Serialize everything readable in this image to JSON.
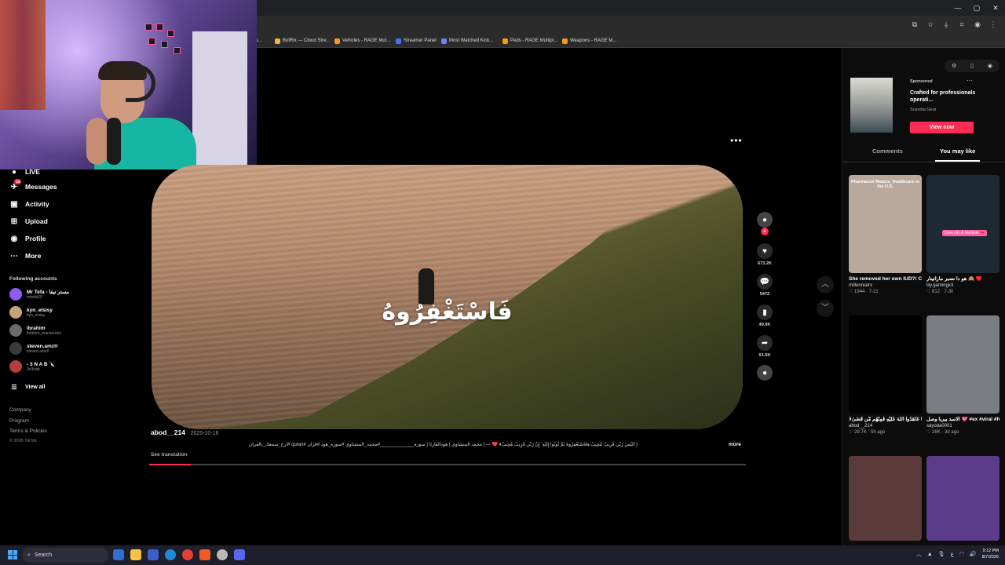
{
  "bookmarks": [
    {
      "label": "rge...",
      "color": "#888888"
    },
    {
      "label": "BotRix — Cloud Stre...",
      "color": "#e9b949"
    },
    {
      "label": "Vehicles - RAGE Mul...",
      "color": "#f39c12"
    },
    {
      "label": "Streamer Panel",
      "color": "#4a6cf7"
    },
    {
      "label": "Most Watched Kick...",
      "color": "#7c7cff"
    },
    {
      "label": "Peds - RAGE Multipl...",
      "color": "#f39c12"
    },
    {
      "label": "Weapons - RAGE M...",
      "color": "#f39c12"
    }
  ],
  "sidebar": {
    "partial_item": "LIVE",
    "messages": {
      "label": "Messages",
      "badge": "14"
    },
    "activity": "Activity",
    "upload": "Upload",
    "profile": "Profile",
    "more": "More",
    "following_title": "Following accounts",
    "accounts": [
      {
        "name": "Mr Tefa - مستر تيفا",
        "handle": "mrtefa20",
        "color": "#8b5cf6"
      },
      {
        "name": "kyn_elsisy",
        "handle": "kyn_elsisy",
        "color": "#c7a27a"
      },
      {
        "name": "ibrahim",
        "handle": "ibrahim_mansourko",
        "color": "#6b6b6b"
      },
      {
        "name": "steven.amz®",
        "handle": "steven.amz0",
        "color": "#3a3a3a"
      },
      {
        "name": "- 3 N A B 🔪",
        "handle": "3n3nab",
        "color": "#b43d3d"
      }
    ],
    "view_all": "View all",
    "footer": [
      "Company",
      "Program",
      "Terms & Policies"
    ],
    "copyright": "© 2026 TikTok"
  },
  "video": {
    "caption": "فَاسْتَغْفِرُوهُ",
    "author": "abod__214",
    "date": "· 2025-10-16",
    "description": "( أَلَيْسَ رَبِّي قَرِيبٌ مُّجِيبٌ ﴿فَاسْتَغْفِرُوهُ ثُمَّ تُوبُوا إِلَيْهِ ۚ إِنَّ رَبِّي قَرِيبٌ مُّجِيبٌ﴾ ❤️ --- | محمد المنشاوي | هودالقارئا | سورة_____________#محمد_المنشاوي #سورة_هود #قرآن #quran #ارح_سمعك_بالقران",
    "more": "more",
    "see_translation": "See translation",
    "progress": 0.07
  },
  "actions": [
    {
      "name": "avatar",
      "icon": "●",
      "count": ""
    },
    {
      "name": "like",
      "icon": "♥",
      "count": "673.2K"
    },
    {
      "name": "comment",
      "icon": "●",
      "count": "5472"
    },
    {
      "name": "save",
      "icon": "▮",
      "count": "49.9K"
    },
    {
      "name": "share",
      "icon": "➦",
      "count": "61.5K"
    },
    {
      "name": "sound",
      "icon": "●",
      "count": ""
    }
  ],
  "ad": {
    "sponsored": "Sponsored",
    "title": "Crafted for professionals operati...",
    "brand": "Scandia Gear",
    "cta": "View now"
  },
  "tabs": [
    "Comments",
    "You may like"
  ],
  "cards": [
    {
      "title": "She removed her own IUD?! Can you remove...",
      "user": "millennialrx",
      "stats": "♡ 1944 · 7-21",
      "overlay": "Pharmacist Reacts: Healthcare in the U.S.",
      "bg": "#b9a89c"
    },
    {
      "title": "هو دا نصبر ماراتينار 🙈 ♥️",
      "user": "lily.gamingx3",
      "stats": "♡ 812 · 7-30",
      "overlay": "",
      "tag": "Core Lily & Martinis 🎀",
      "bg": "#1d2a33"
    },
    {
      "title": "﴿إِنَّ الْمُؤْمِنِينَ رِجَالٌ صَدَقُوا مَا عَاهَدُوا اللَّهَ عَلَيْهِ فَمِنْهُم مَّن قَضَىٰ﴾",
      "user": "abod__214",
      "stats": "♡ 29.7K · 5h ago",
      "overlay": "",
      "bg": "#000000"
    },
    {
      "title": "الاسد بيربا وصل 💖 #ex #viral #fouryou...",
      "user": "sayoda0001",
      "stats": "♡ 26K · 3d ago",
      "overlay": "",
      "bg": "#7a7d82"
    },
    {
      "title": "",
      "user": "",
      "stats": "",
      "overlay": "",
      "bg": "#5a3a3a"
    },
    {
      "title": "",
      "user": "",
      "stats": "",
      "overlay": "",
      "bg": "#5b3b8a"
    }
  ],
  "taskbar": {
    "search": "Search",
    "time": "9:12 PM",
    "date": "8/7/2026"
  }
}
